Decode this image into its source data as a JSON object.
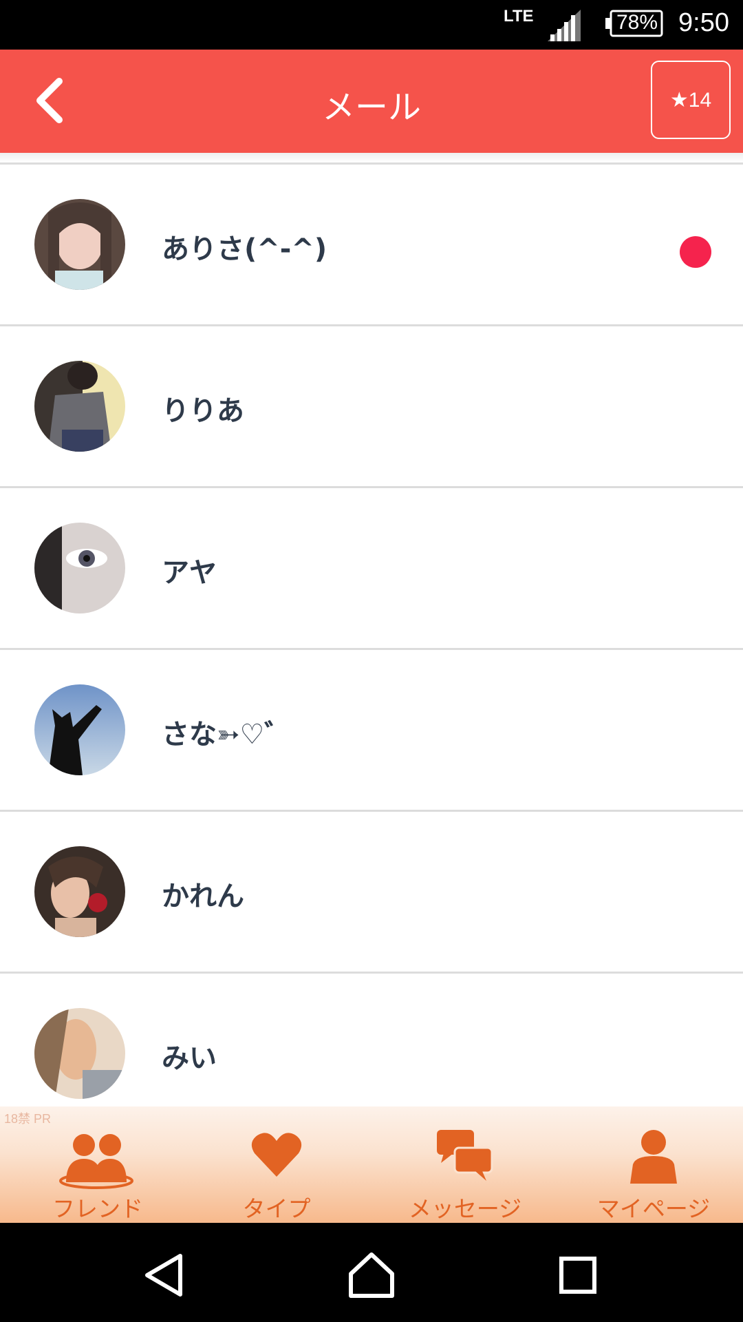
{
  "status_bar": {
    "network": "LTE",
    "battery": "78%",
    "time": "9:50"
  },
  "header": {
    "title": "メール",
    "star_count": "★14"
  },
  "mail_list": [
    {
      "name": "ありさ(^-^)",
      "unread": true
    },
    {
      "name": "りりあ",
      "unread": false
    },
    {
      "name": "アヤ",
      "unread": false
    },
    {
      "name": "さな➳♡゛",
      "unread": false
    },
    {
      "name": "かれん",
      "unread": false
    },
    {
      "name": "みい",
      "unread": false
    }
  ],
  "tab_bar": {
    "pr_label": "18禁 PR",
    "tabs": [
      {
        "label": "フレンド",
        "icon": "friends-icon"
      },
      {
        "label": "タイプ",
        "icon": "heart-icon"
      },
      {
        "label": "メッセージ",
        "icon": "message-icon"
      },
      {
        "label": "マイページ",
        "icon": "person-icon"
      }
    ]
  },
  "nav_bar": {
    "icons": [
      "back-triangle-icon",
      "home-icon",
      "recents-icon"
    ]
  },
  "colors": {
    "header": "#f5534b",
    "unread_dot": "#f5234d",
    "tab_accent": "#e26323",
    "name_text": "#2e3a4a"
  }
}
